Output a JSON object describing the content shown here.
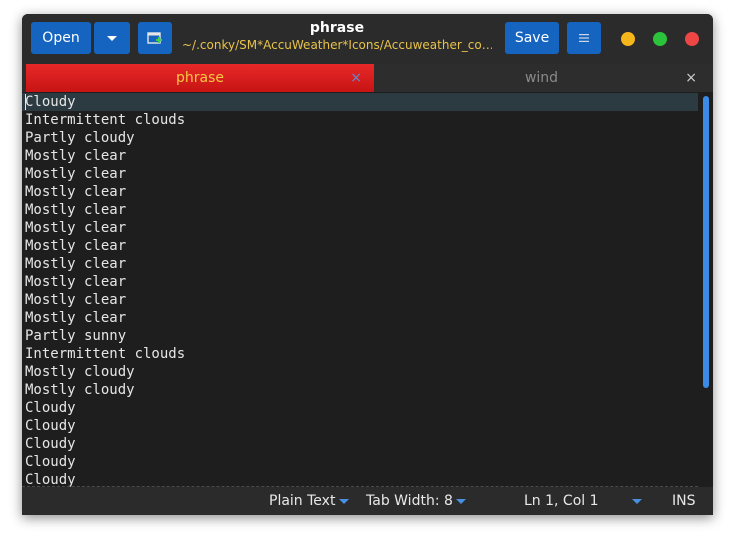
{
  "header": {
    "open_label": "Open",
    "save_label": "Save",
    "title": "phrase",
    "subtitle": "~/.conky/SM*AccuWeather*Icons/Accuweather_co…"
  },
  "tabs": [
    {
      "label": "phrase",
      "close": "×",
      "active": true
    },
    {
      "label": "wind",
      "close": "×",
      "active": false
    }
  ],
  "editor": {
    "lines": [
      "Cloudy",
      "Intermittent clouds",
      "Partly cloudy",
      "Mostly clear",
      "Mostly clear",
      "Mostly clear",
      "Mostly clear",
      "Mostly clear",
      "Mostly clear",
      "Mostly clear",
      "Mostly clear",
      "Mostly clear",
      "Mostly clear",
      "Partly sunny",
      "Intermittent clouds",
      "Mostly cloudy",
      "Mostly cloudy",
      "Cloudy",
      "Cloudy",
      "Cloudy",
      "Cloudy",
      "Cloudy"
    ]
  },
  "status": {
    "language": "Plain Text",
    "tab_width": "Tab Width: 8",
    "position": "Ln 1, Col 1",
    "mode": "INS"
  },
  "colors": {
    "accent": "#1565c0",
    "active_tab": "#e02020",
    "active_tab_text": "#f5c842",
    "subtitle": "#e8c24a",
    "scrollbar": "#3b8be6"
  },
  "icons": {
    "open_menu": "chevron-down-icon",
    "new_tab": "new-document-icon",
    "main_menu": "hamburger-menu-icon"
  }
}
